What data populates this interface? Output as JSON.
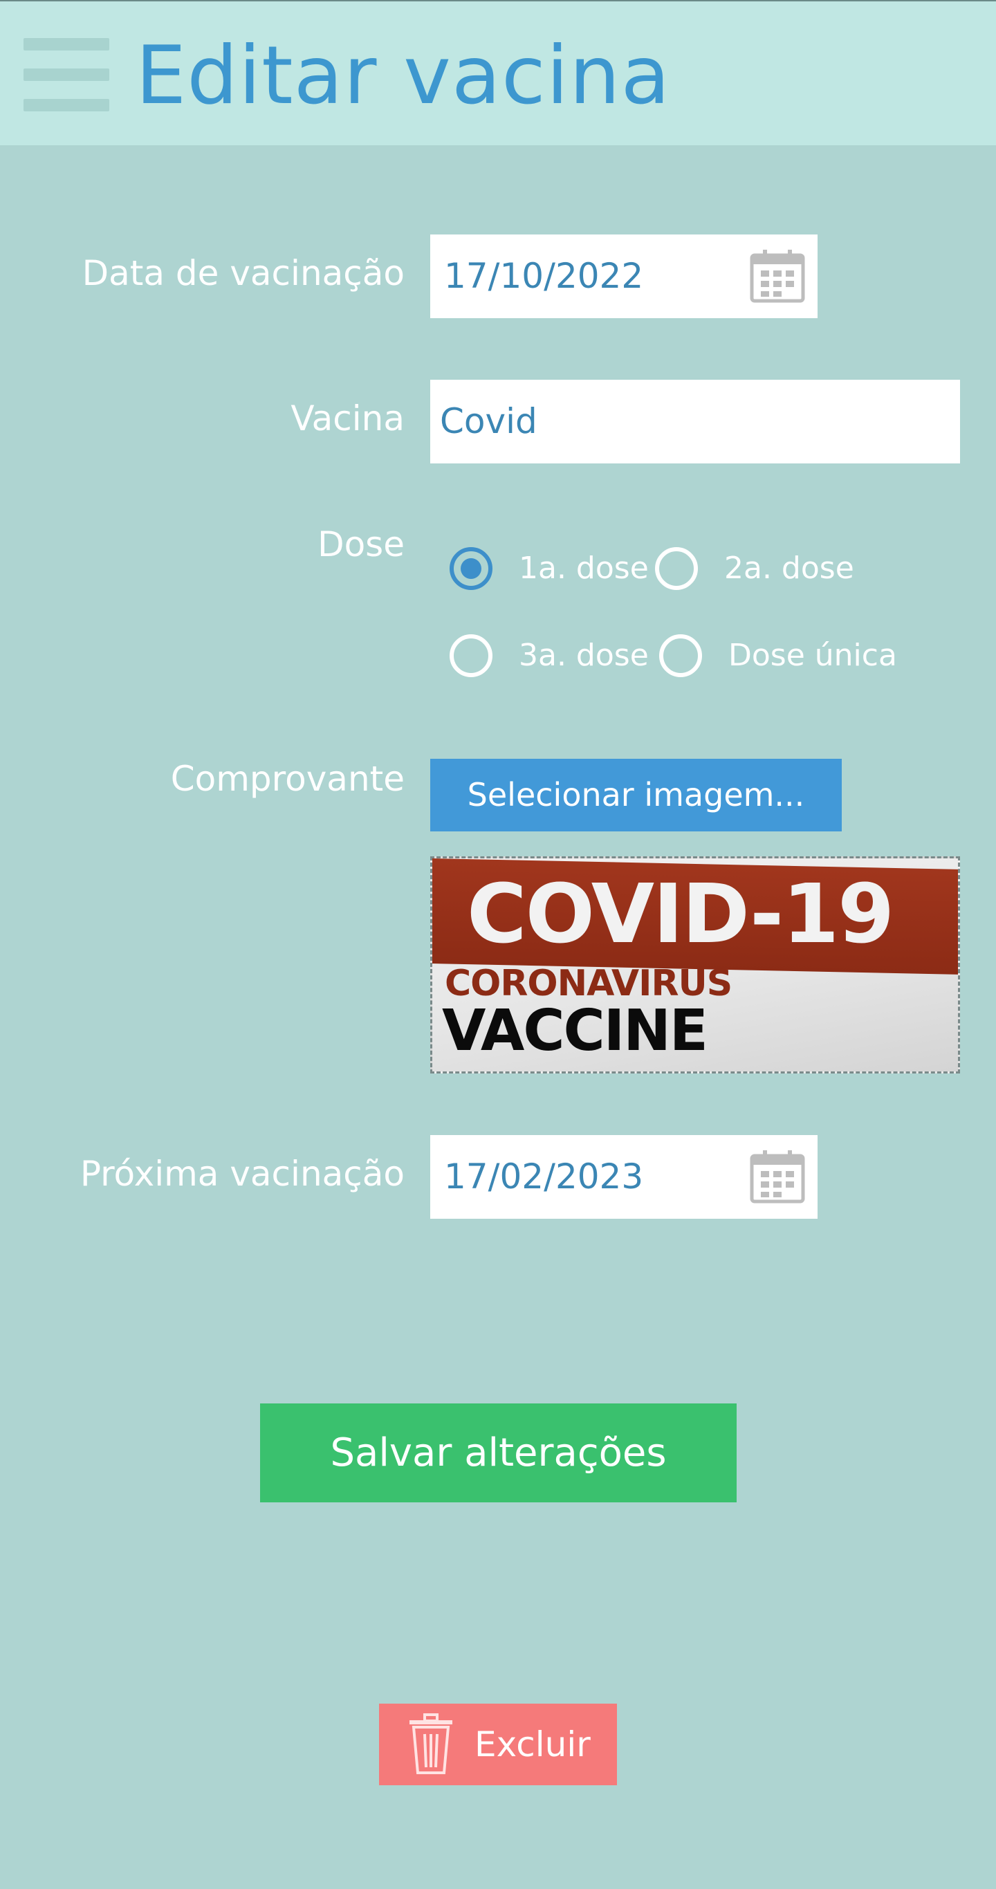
{
  "header": {
    "title": "Editar vacina",
    "menu_icon": "hamburger-menu-icon"
  },
  "form": {
    "vaccination_date": {
      "label": "Data de vacinação",
      "value": "17/10/2022",
      "icon": "calendar-icon"
    },
    "vaccine": {
      "label": "Vacina",
      "value": "Covid"
    },
    "dose": {
      "label": "Dose",
      "selected": "1a. dose",
      "options": [
        "1a. dose",
        "2a. dose",
        "3a. dose",
        "Dose única"
      ]
    },
    "proof": {
      "label": "Comprovante",
      "button_label": "Selecionar imagem...",
      "preview": {
        "line1": "COVID-19",
        "line2": "CORONAVIRUS",
        "line3": "VACCINE"
      }
    },
    "next_vaccination": {
      "label": "Próxima vacinação",
      "value": "17/02/2023",
      "icon": "calendar-icon"
    }
  },
  "actions": {
    "save_label": "Salvar alterações",
    "delete_label": "Excluir",
    "delete_icon": "trash-icon"
  },
  "colors": {
    "background": "#aed4d1",
    "header_background": "#c0e7e3",
    "title": "#3d97cf",
    "input_text": "#3b86b4",
    "radio_selected": "#3d8fca",
    "select_button": "#4299d8",
    "save_button": "#3ac16e",
    "delete_button": "#f57a7a"
  }
}
